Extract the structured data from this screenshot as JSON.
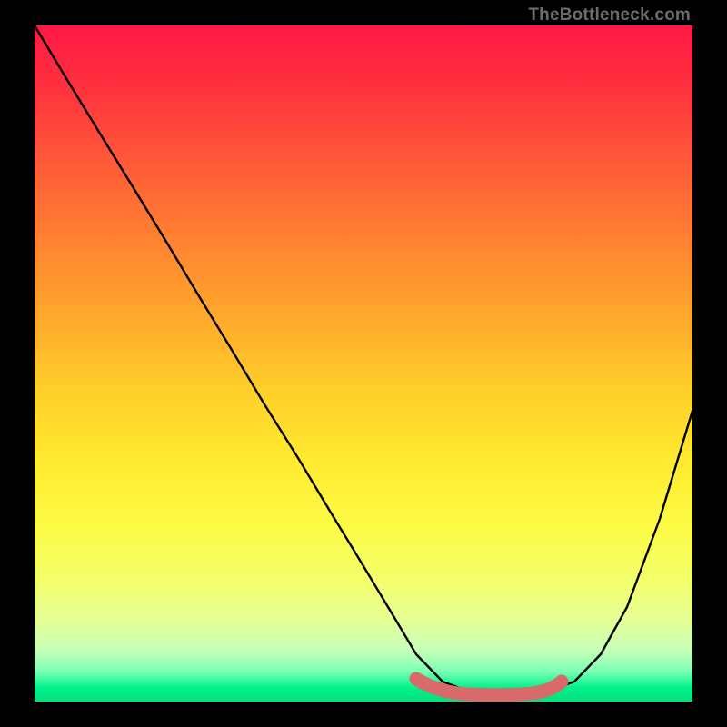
{
  "watermark": "TheBottleneck.com",
  "chart_data": {
    "type": "line",
    "title": "",
    "xlabel": "",
    "ylabel": "",
    "xlim": [
      0,
      100
    ],
    "ylim": [
      0,
      100
    ],
    "grid": false,
    "legend": null,
    "series": [
      {
        "name": "bottleneck-curve",
        "color": "#000000",
        "x": [
          0,
          5,
          10,
          15,
          20,
          25,
          30,
          35,
          40,
          45,
          50,
          55,
          58,
          62,
          66,
          70,
          74,
          78,
          82,
          86,
          90,
          95,
          100
        ],
        "y": [
          100,
          92,
          84,
          76,
          68,
          60,
          52,
          44,
          36,
          28,
          20,
          12,
          7,
          3,
          1.5,
          1.3,
          1.3,
          1.5,
          3,
          7,
          14,
          27,
          43
        ]
      },
      {
        "name": "optimal-zone-marker",
        "color": "#d86a6a",
        "x": [
          58,
          62,
          66,
          70,
          74,
          78,
          80
        ],
        "y": [
          3.3,
          2.2,
          1.7,
          1.6,
          1.7,
          2.2,
          3.0
        ]
      }
    ],
    "background_gradient": {
      "top_color": "#ff1845",
      "mid_color": "#ffe92e",
      "bottom_color": "#00e07e"
    }
  }
}
